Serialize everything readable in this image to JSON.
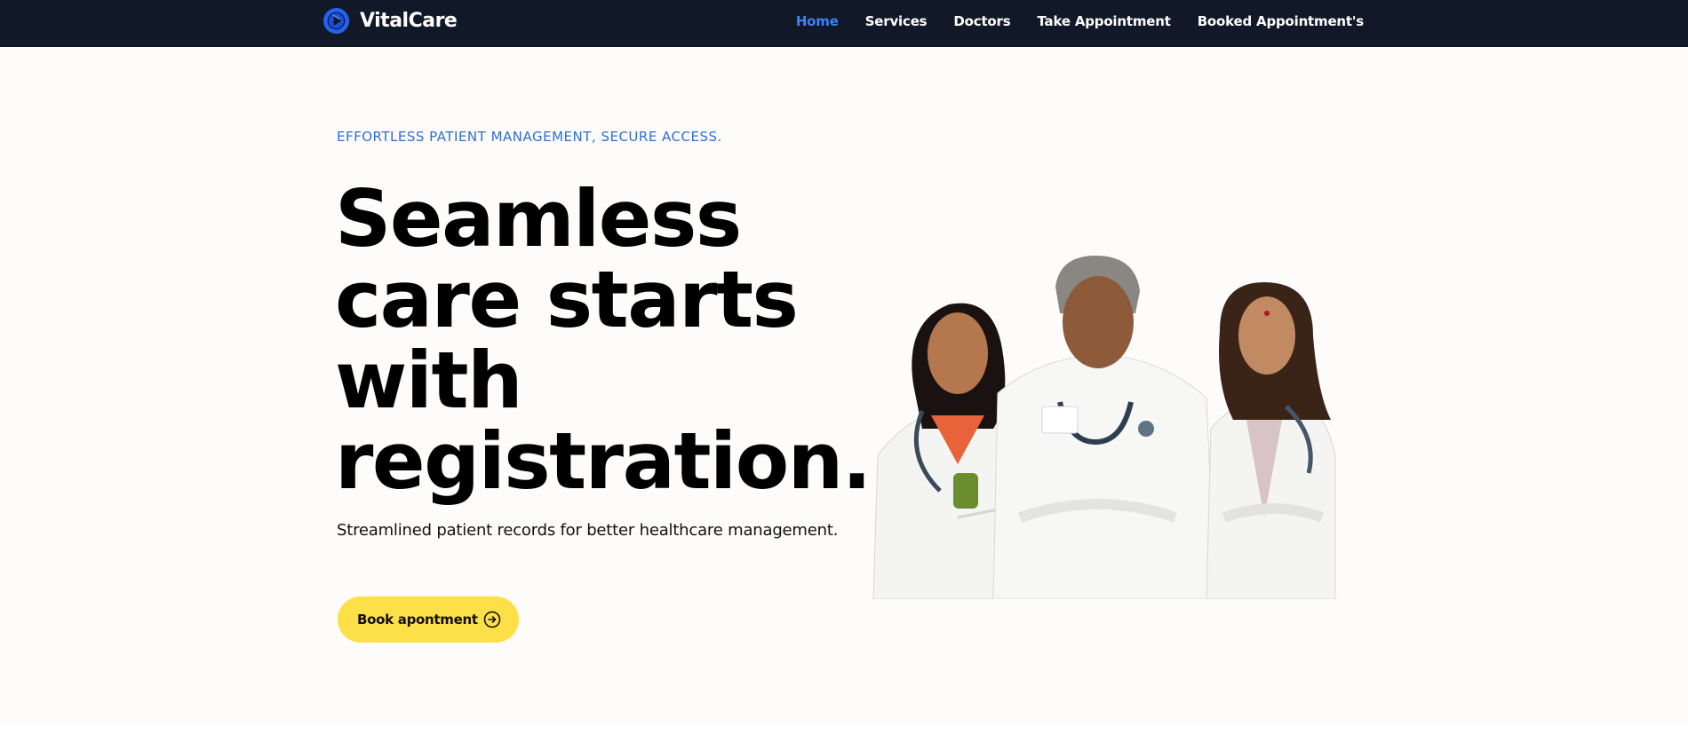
{
  "brand": {
    "name": "VitalCare",
    "logo_icon": "play-circle-icon",
    "logo_color": "#2563eb"
  },
  "nav": {
    "items": [
      {
        "label": "Home",
        "active": true
      },
      {
        "label": "Services",
        "active": false
      },
      {
        "label": "Doctors",
        "active": false
      },
      {
        "label": "Take Appointment",
        "active": false
      },
      {
        "label": "Booked Appointment's",
        "active": false
      }
    ],
    "active_color": "#3b82f6"
  },
  "hero": {
    "eyebrow": "EFFORTLESS PATIENT MANAGEMENT, SECURE ACCESS.",
    "headline": "Seamless care starts with registration.",
    "subtitle": "Streamlined patient records for better healthcare management.",
    "cta": {
      "label": "Book apontment",
      "icon": "arrow-right-circle-icon",
      "color": "#fde047"
    },
    "image": "three-doctors-in-white-coats-photo"
  },
  "colors": {
    "topbar": "#111827",
    "background": "#fdfcfa",
    "accent": "#2f6fd1"
  }
}
